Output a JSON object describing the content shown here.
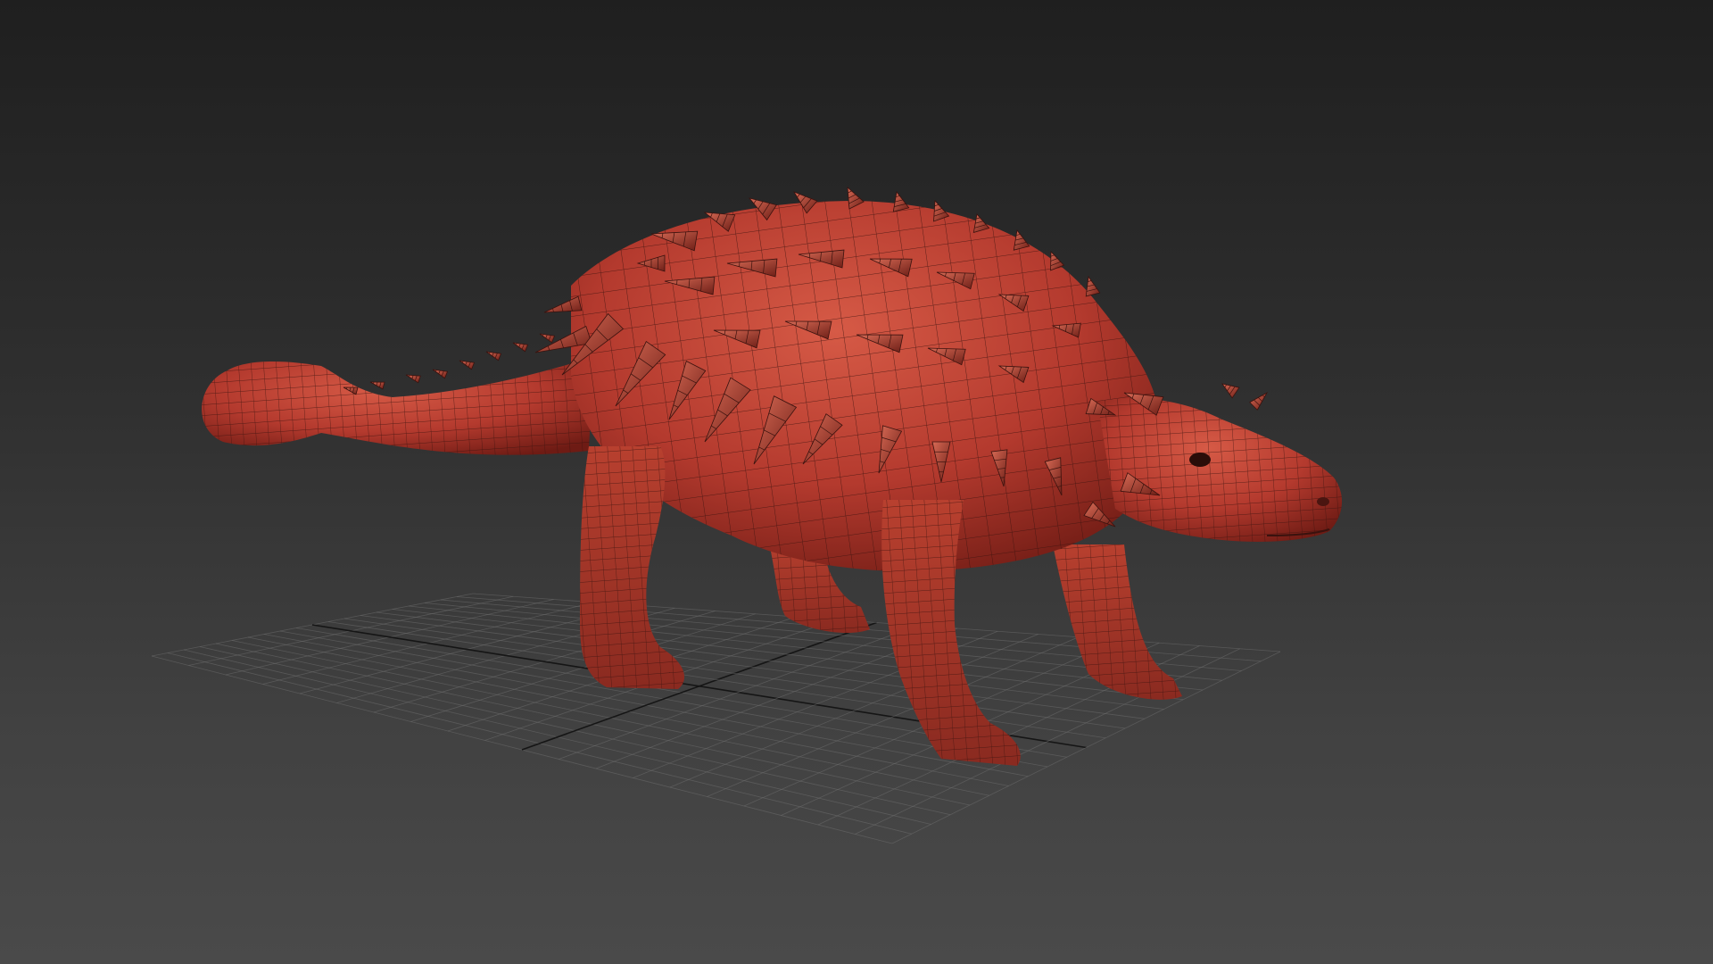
{
  "viewport": {
    "view": "perspective",
    "shading": "wireframe-on-shaded",
    "background_top": "#1f1f1f",
    "background_bottom": "#4a4a4a",
    "grid_color": "#6e6e6e",
    "axis_color": "#111111"
  },
  "model": {
    "subject": "ankylosaurus",
    "material_color": "#b43a2e",
    "shadow_color": "#6e1b14",
    "highlight_color": "#d8644f",
    "wire_color": "#3a120e"
  }
}
